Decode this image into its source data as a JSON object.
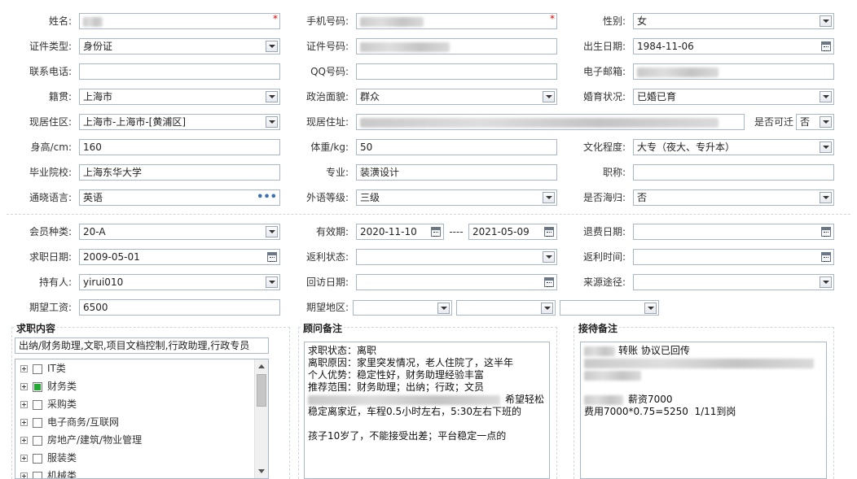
{
  "basic": {
    "name": {
      "label": "姓名:",
      "required_mark": "*"
    },
    "phone": {
      "label": "手机号码:",
      "required_mark": "*"
    },
    "gender": {
      "label": "性别:",
      "value": "女"
    },
    "id_type": {
      "label": "证件类型:",
      "value": "身份证"
    },
    "id_number": {
      "label": "证件号码:"
    },
    "birth_date": {
      "label": "出生日期:",
      "value": "1984-11-06"
    },
    "contact_phone": {
      "label": "联系电话:",
      "value": ""
    },
    "qq": {
      "label": "QQ号码:",
      "value": ""
    },
    "email": {
      "label": "电子邮箱:"
    },
    "native_place": {
      "label": "籍贯:",
      "value": "上海市"
    },
    "political_status": {
      "label": "政治面貌:",
      "value": "群众"
    },
    "marital_status": {
      "label": "婚育状况:",
      "value": "已婚已育"
    },
    "current_area": {
      "label": "现居住区:",
      "value": "上海市-上海市-[黄浦区]"
    },
    "current_address": {
      "label": "现居住址:"
    },
    "relocate": {
      "label": "是否可迁",
      "value": "否"
    },
    "height": {
      "label": "身高/cm:",
      "value": "160"
    },
    "weight": {
      "label": "体重/kg:",
      "value": "50"
    },
    "education": {
      "label": "文化程度:",
      "value": "大专（夜大、专升本）"
    },
    "school": {
      "label": "毕业院校:",
      "value": "上海东华大学"
    },
    "major": {
      "label": "专业:",
      "value": "装潢设计"
    },
    "title": {
      "label": "职称:",
      "value": ""
    },
    "language": {
      "label": "通晓语言:",
      "value": "英语",
      "more": "•••"
    },
    "language_level": {
      "label": "外语等级:",
      "value": "三级"
    },
    "overseas_return": {
      "label": "是否海归:",
      "value": "否"
    }
  },
  "membership": {
    "member_type": {
      "label": "会员种类:",
      "value": "20-A"
    },
    "valid_period": {
      "label": "有效期:",
      "start": "2020-11-10",
      "separator": "----",
      "end": "2021-05-09"
    },
    "refund_date": {
      "label": "退费日期:",
      "value": ""
    },
    "job_seek_date": {
      "label": "求职日期:",
      "value": "2009-05-01"
    },
    "rebate_status": {
      "label": "返利状态:",
      "value": ""
    },
    "rebate_time": {
      "label": "返利时间:",
      "value": ""
    },
    "holder": {
      "label": "持有人:",
      "value": "yirui010"
    },
    "revisit_date": {
      "label": "回访日期:",
      "value": ""
    },
    "source": {
      "label": "来源途径:",
      "value": ""
    },
    "expected_salary": {
      "label": "期望工资:",
      "value": "6500"
    },
    "expected_area": {
      "label": "期望地区:",
      "values": [
        "",
        "",
        ""
      ]
    }
  },
  "job_content": {
    "title": "求职内容",
    "summary": "出纳/财务助理,文职,项目文档控制,行政助理,行政专员",
    "tree": [
      {
        "label": "IT类",
        "checked": false
      },
      {
        "label": "财务类",
        "checked": true
      },
      {
        "label": "采购类",
        "checked": false
      },
      {
        "label": "电子商务/互联网",
        "checked": false
      },
      {
        "label": "房地产/建筑/物业管理",
        "checked": false
      },
      {
        "label": "服装类",
        "checked": false
      },
      {
        "label": "机械类",
        "checked": false
      }
    ]
  },
  "consultant_notes": {
    "title": "顾问备注",
    "line1": "求职状态：离职",
    "line2": "离职原因：家里突发情况，老人住院了，这半年",
    "line3": "个人优势：稳定性好，财务助理经验丰富",
    "line4": "推荐范围：财务助理；出纳；行政；文员",
    "line5_tail": "希望轻松",
    "line6": "稳定离家近，车程0.5小时左右，5:30左右下班的",
    "line8": "孩子10岁了，不能接受出差；平台稳定一点的"
  },
  "reception_notes": {
    "title": "接待备注",
    "line1_tail": "转账 协议已回传",
    "line4_tail": "薪资7000",
    "line5": "费用7000*0.75=5250  1/11到岗"
  },
  "colors": {
    "required": "#e00000",
    "checked": "#22a833",
    "border": "#a9b8c8"
  }
}
